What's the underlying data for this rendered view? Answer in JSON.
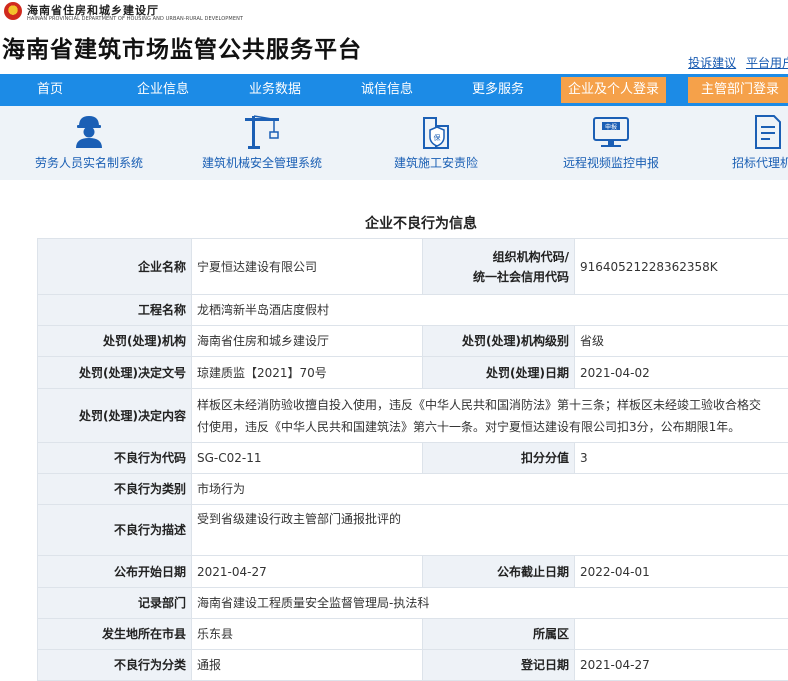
{
  "header": {
    "dept_cn": "海南省住房和城乡建设厅",
    "dept_en": "HAINAN PROVINCIAL DEPARTMENT OF HOUSING AND URBAN-RURAL DEVELOPMENT",
    "site_title": "海南省建筑市场监管公共服务平台",
    "links": [
      "投诉建议",
      "平台用户"
    ]
  },
  "nav": {
    "items": [
      "首页",
      "企业信息",
      "业务数据",
      "诚信信息",
      "更多服务"
    ],
    "login_company": "企业及个人登录",
    "login_admin": "主管部门登录",
    "color": "#1c8be6",
    "accent": "#f5a14a"
  },
  "systems": [
    {
      "label": "劳务人员实名制系统",
      "icon": "worker-icon"
    },
    {
      "label": "建筑机械安全管理系统",
      "icon": "crane-icon"
    },
    {
      "label": "建筑施工安责险",
      "icon": "insurance-icon"
    },
    {
      "label": "远程视频监控申报",
      "icon": "monitor-icon"
    },
    {
      "label": "招标代理机构",
      "icon": "document-icon"
    }
  ],
  "page": {
    "title": "企业不良行为信息"
  },
  "record": {
    "company_name_label": "企业名称",
    "company_name": "宁夏恒达建设有限公司",
    "org_code_label_1": "组织机构代码/",
    "org_code_label_2": "统一社会信用代码",
    "org_code": "91640521228362358K",
    "project_label": "工程名称",
    "project": "龙栖湾新半岛酒店度假村",
    "authority_label": "处罚(处理)机构",
    "authority": "海南省住房和城乡建设厅",
    "authority_level_label": "处罚(处理)机构级别",
    "authority_level": "省级",
    "doc_no_label": "处罚(处理)决定文号",
    "doc_no": "琼建质监【2021】70号",
    "date_label": "处罚(处理)日期",
    "date": "2021-04-02",
    "content_label": "处罚(处理)决定内容",
    "content": "样板区未经消防验收擅自投入使用，违反《中华人民共和国消防法》第十三条；样板区未经竣工验收合格交付使用，违反《中华人民共和国建筑法》第六十一条。对宁夏恒达建设有限公司扣3分，公布期限1年。",
    "code_label": "不良行为代码",
    "code": "SG-C02-11",
    "score_label": "扣分分值",
    "score": "3",
    "category_label": "不良行为类别",
    "category": "市场行为",
    "desc_label": "不良行为描述",
    "desc": "受到省级建设行政主管部门通报批评的",
    "pub_start_label": "公布开始日期",
    "pub_start": "2021-04-27",
    "pub_end_label": "公布截止日期",
    "pub_end": "2022-04-01",
    "record_dept_label": "记录部门",
    "record_dept": "海南省建设工程质量安全监督管理局-执法科",
    "city_label": "发生地所在市县",
    "city": "乐东县",
    "district_label": "所属区",
    "district": "",
    "class_label": "不良行为分类",
    "class": "通报",
    "reg_date_label": "登记日期",
    "reg_date": "2021-04-27"
  }
}
